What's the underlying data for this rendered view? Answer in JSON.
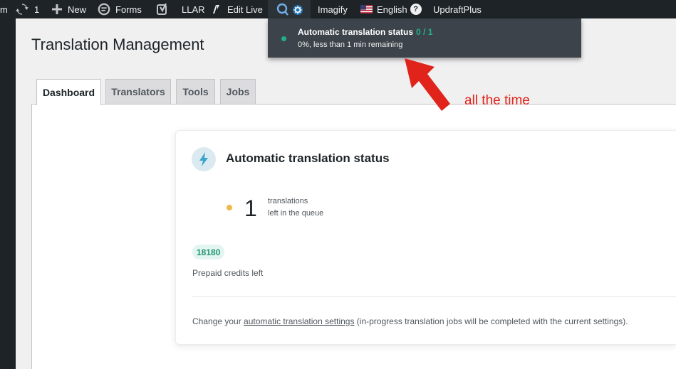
{
  "admin_bar": {
    "site_letter": "m",
    "updates_count": "1",
    "new_label": "New",
    "forms_label": "Forms",
    "llar_label": "LLAR",
    "edit_live_label": "Edit Live",
    "imagify_label": "Imagify",
    "language_label": "English",
    "language_help": "?",
    "updraft_label": "UpdraftPlus"
  },
  "dropdown": {
    "title": "Automatic translation status",
    "count": "0 / 1",
    "subtitle": "0%, less than 1 min remaining"
  },
  "page": {
    "title": "Translation Management",
    "tabs": [
      {
        "label": "Dashboard",
        "active": true
      },
      {
        "label": "Translators",
        "active": false
      },
      {
        "label": "Tools",
        "active": false
      },
      {
        "label": "Jobs",
        "active": false
      }
    ]
  },
  "card": {
    "title": "Automatic translation status",
    "queue_count": "1",
    "queue_label_line1": "translations",
    "queue_label_line2": "left in the queue",
    "credits_value": "18180",
    "credits_label": "Prepaid credits left",
    "note_before": "Change your ",
    "note_link": "automatic translation settings",
    "note_after": " (in-progress translation jobs will be completed with the current settings)."
  },
  "annotation": {
    "text": "all the time"
  },
  "colors": {
    "admin_bar_bg": "#1d2327",
    "dropdown_bg": "#3c434a",
    "status_green": "#22b08c",
    "queue_dot_yellow": "#f0b849",
    "credits_green": "#23956f",
    "annotation_red": "#e0241b",
    "bolt_blue": "#3aa5c9"
  },
  "icons": {
    "updates": "refresh-icon",
    "new": "plus-icon",
    "forms": "forms-icon",
    "seo": "yoast-icon",
    "edit_live": "edit-live-icon",
    "wpml": "wpml-gear-icon",
    "language": "us-flag-icon",
    "status": "lightning-bolt-icon"
  }
}
